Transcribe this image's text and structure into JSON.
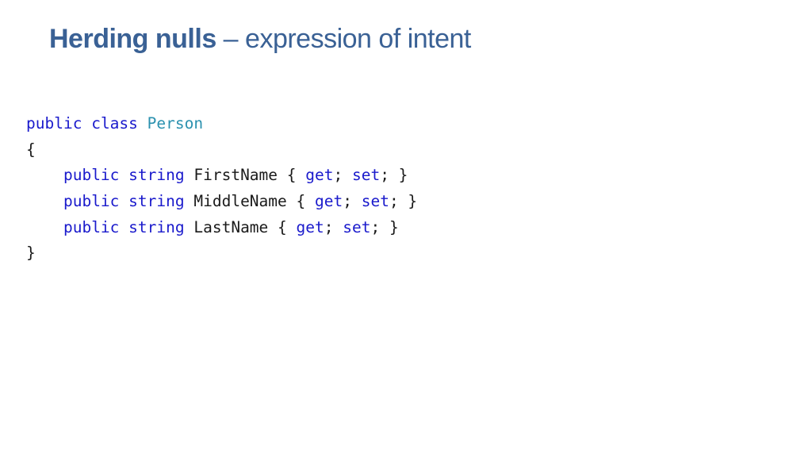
{
  "slide": {
    "title_bold": "Herding nulls",
    "title_rest": " – expression of intent"
  },
  "code": {
    "lines": [
      [
        {
          "t": "public",
          "c": "kw"
        },
        {
          "t": " "
        },
        {
          "t": "class",
          "c": "kw"
        },
        {
          "t": " "
        },
        {
          "t": "Person",
          "c": "type"
        }
      ],
      [
        {
          "t": "{"
        }
      ],
      [
        {
          "t": "    "
        },
        {
          "t": "public",
          "c": "kw"
        },
        {
          "t": " "
        },
        {
          "t": "string",
          "c": "kw"
        },
        {
          "t": " FirstName { "
        },
        {
          "t": "get",
          "c": "kw"
        },
        {
          "t": "; "
        },
        {
          "t": "set",
          "c": "kw"
        },
        {
          "t": "; }"
        }
      ],
      [
        {
          "t": "    "
        },
        {
          "t": "public",
          "c": "kw"
        },
        {
          "t": " "
        },
        {
          "t": "string",
          "c": "kw"
        },
        {
          "t": " MiddleName { "
        },
        {
          "t": "get",
          "c": "kw"
        },
        {
          "t": "; "
        },
        {
          "t": "set",
          "c": "kw"
        },
        {
          "t": "; }"
        }
      ],
      [
        {
          "t": "    "
        },
        {
          "t": "public",
          "c": "kw"
        },
        {
          "t": " "
        },
        {
          "t": "string",
          "c": "kw"
        },
        {
          "t": " LastName { "
        },
        {
          "t": "get",
          "c": "kw"
        },
        {
          "t": "; "
        },
        {
          "t": "set",
          "c": "kw"
        },
        {
          "t": "; }"
        }
      ],
      [
        {
          "t": "}"
        }
      ]
    ]
  },
  "colors": {
    "title": "#3a6195",
    "keyword": "#1a1acc",
    "type": "#2b91af",
    "text": "#1a1a1a"
  }
}
